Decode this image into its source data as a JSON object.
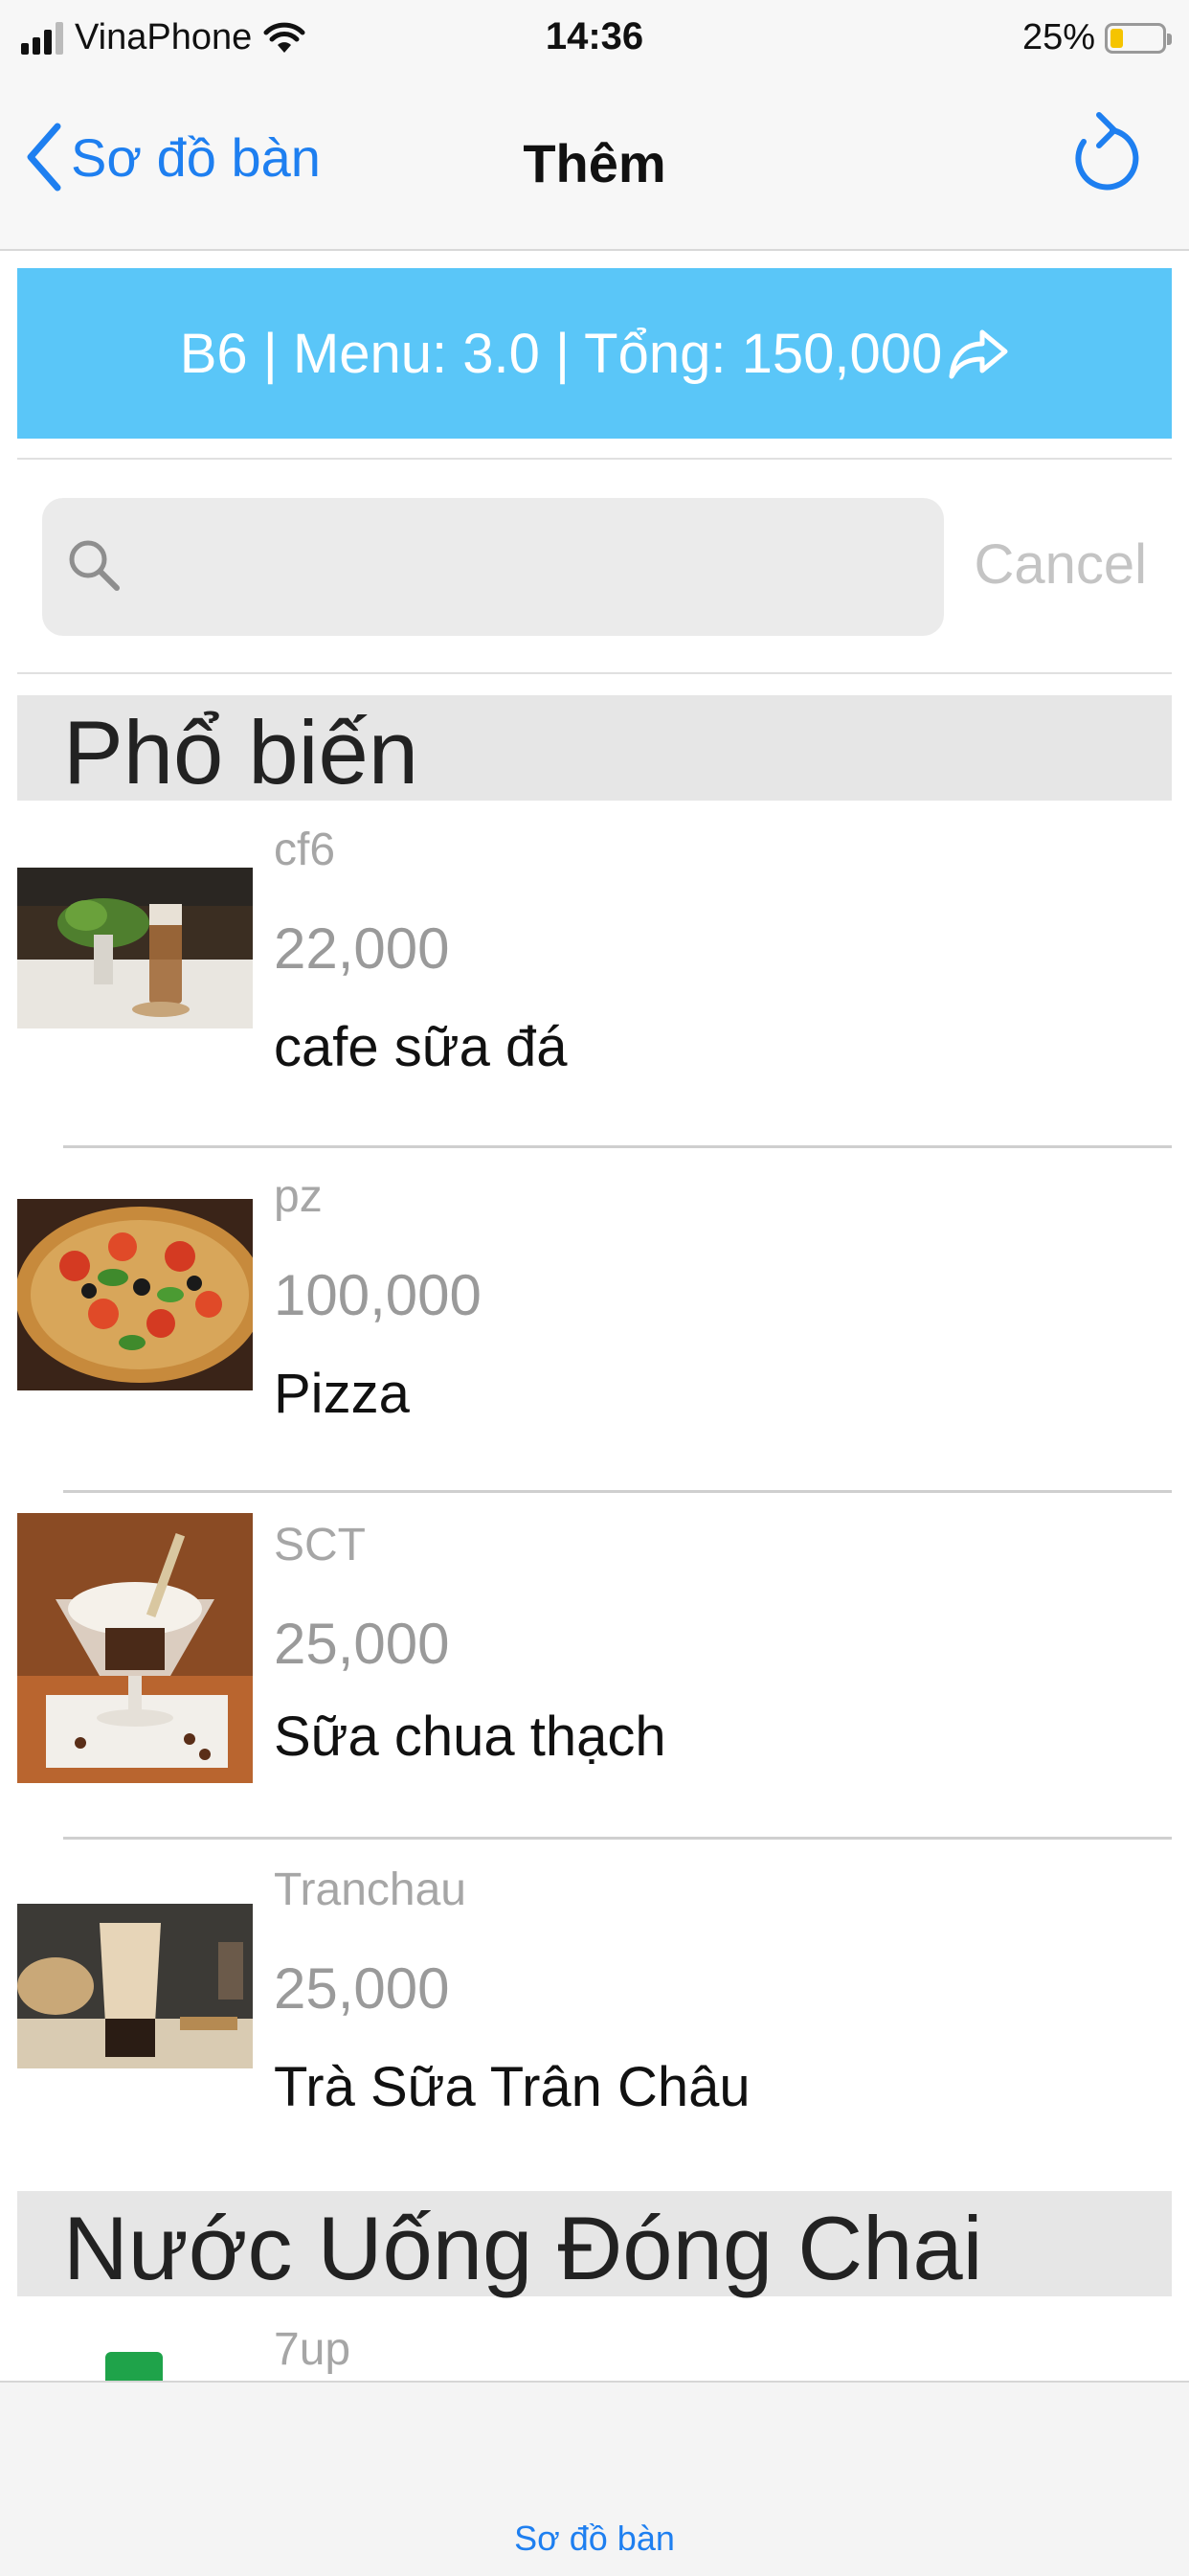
{
  "status_bar": {
    "carrier": "VinaPhone",
    "time": "14:36",
    "battery_percent": "25%",
    "battery_level": 0.25
  },
  "nav": {
    "back_label": "Sơ đồ bàn",
    "title": "Thêm",
    "refresh_icon": "refresh-icon"
  },
  "banner": {
    "text": "B6 | Menu: 3.0 | Tổng: 150,000",
    "icon": "share-arrow-icon",
    "color": "#5ac6f8"
  },
  "search": {
    "value": "",
    "placeholder": "",
    "cancel_label": "Cancel"
  },
  "sections": [
    {
      "title": "Phổ biến",
      "items": [
        {
          "code": "cf6",
          "price": "22,000",
          "name": "cafe sữa đá"
        },
        {
          "code": "pz",
          "price": "100,000",
          "name": "Pizza"
        },
        {
          "code": "SCT",
          "price": "25,000",
          "name": "Sữa chua thạch"
        },
        {
          "code": "Tranchau",
          "price": "25,000",
          "name": "Trà Sữa Trân Châu"
        }
      ]
    },
    {
      "title": "Nước Uống Đóng Chai",
      "items": [
        {
          "code": "7up"
        }
      ]
    }
  ],
  "tab_bar": {
    "label": "Sơ đồ bàn"
  },
  "colors": {
    "accent": "#1e7ff0",
    "banner": "#5ac6f8"
  }
}
